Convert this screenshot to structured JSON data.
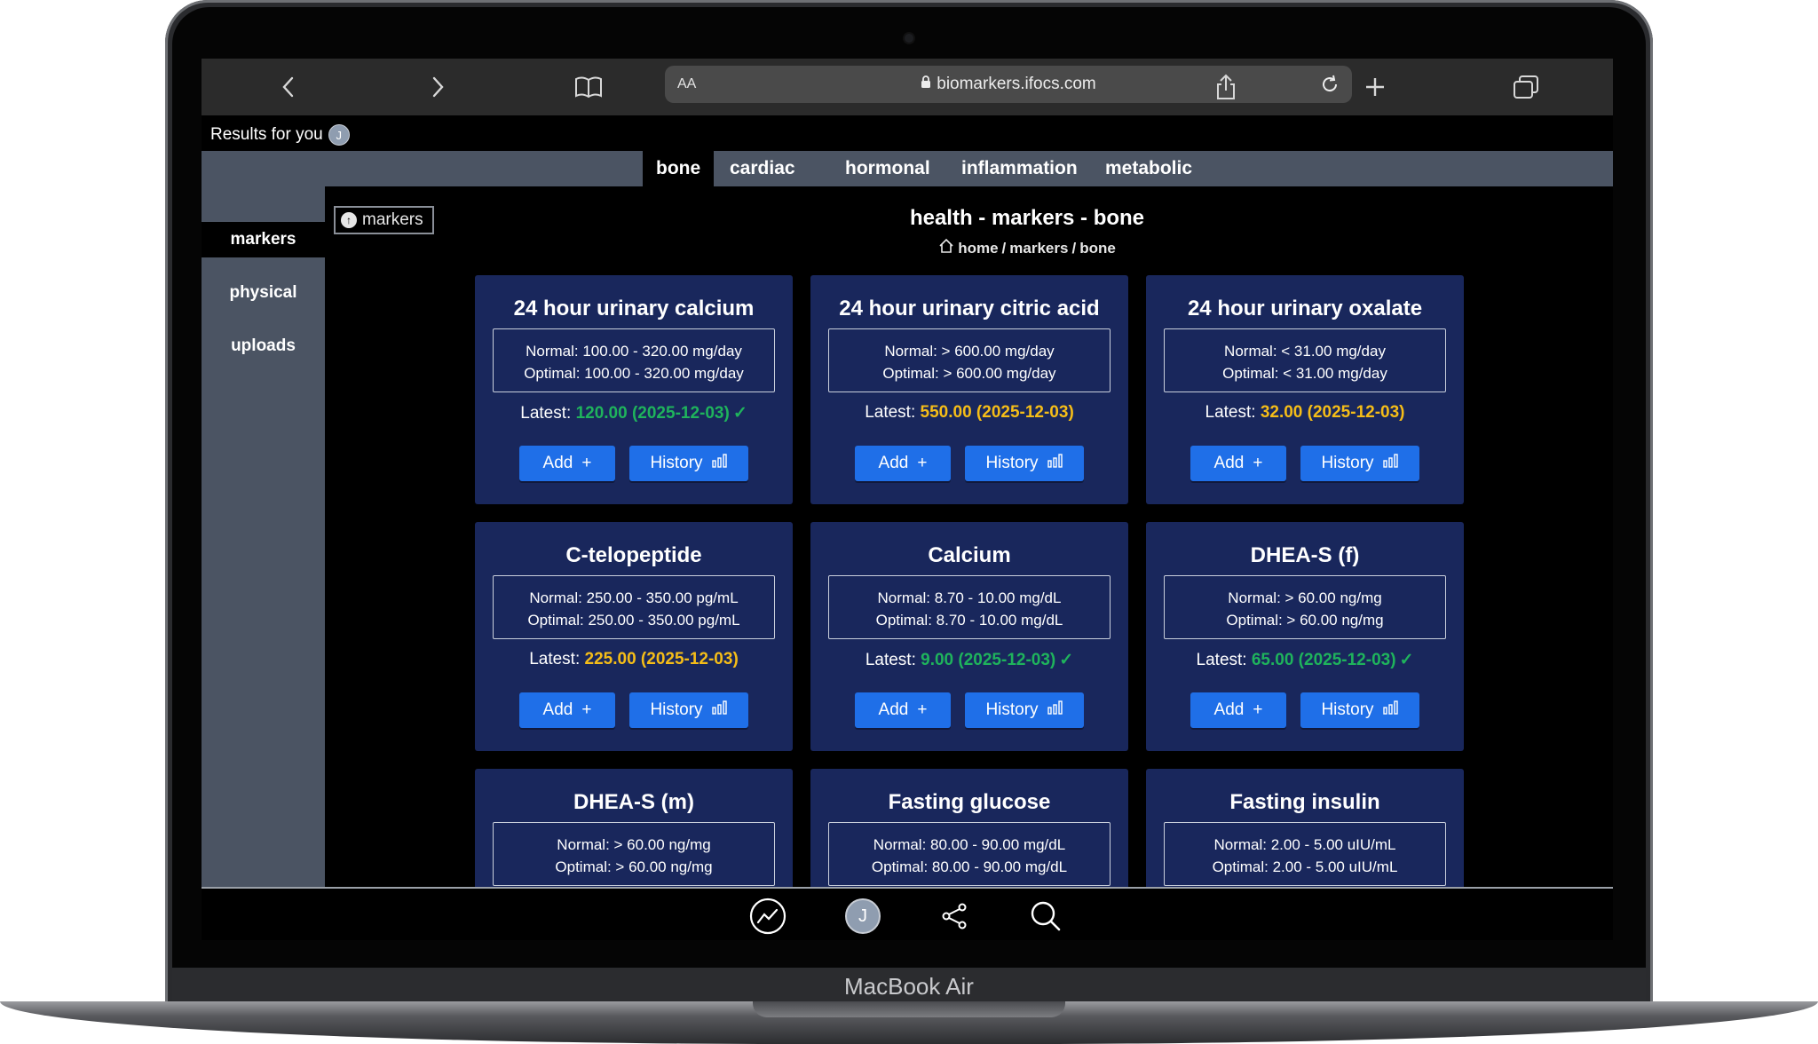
{
  "device": {
    "label": "MacBook Air"
  },
  "browser": {
    "text_size_label": "AA",
    "url": "biomarkers.ifocs.com",
    "icons": [
      "back-icon",
      "forward-icon",
      "bookmarks-icon",
      "lock-icon",
      "reload-icon",
      "share-icon",
      "new-tab-icon",
      "tabs-icon"
    ]
  },
  "header": {
    "results_label": "Results for you",
    "user_initial": "J"
  },
  "tabs": [
    {
      "label": "bone",
      "active": true
    },
    {
      "label": "cardiac",
      "active": false
    },
    {
      "label": "hormonal",
      "active": false
    },
    {
      "label": "inflammation",
      "active": false
    },
    {
      "label": "metabolic",
      "active": false
    }
  ],
  "sidebar": {
    "items": [
      {
        "label": "markers",
        "active": true
      },
      {
        "label": "physical",
        "active": false
      },
      {
        "label": "uploads",
        "active": false
      }
    ]
  },
  "markers_badge": "markers",
  "page": {
    "title": "health - markers - bone",
    "breadcrumb": {
      "home": "home",
      "sep1": "/",
      "markers": "markers",
      "sep2": "/",
      "current": "bone"
    }
  },
  "cards": [
    {
      "title": "24 hour urinary calcium",
      "normal": "Normal: 100.00 - 320.00 mg/day",
      "optimal": "Optimal: 100.00 - 320.00 mg/day",
      "latest_label": "Latest:",
      "latest_value": "120.00 (2025-12-03)",
      "status": "green",
      "check": "✓",
      "add": "Add",
      "history": "History"
    },
    {
      "title": "24 hour urinary citric acid",
      "normal": "Normal: > 600.00 mg/day",
      "optimal": "Optimal: > 600.00 mg/day",
      "latest_label": "Latest:",
      "latest_value": "550.00 (2025-12-03)",
      "status": "amber",
      "check": "",
      "add": "Add",
      "history": "History"
    },
    {
      "title": "24 hour urinary oxalate",
      "normal": "Normal: < 31.00 mg/day",
      "optimal": "Optimal: < 31.00 mg/day",
      "latest_label": "Latest:",
      "latest_value": "32.00 (2025-12-03)",
      "status": "amber",
      "check": "",
      "add": "Add",
      "history": "History"
    },
    {
      "title": "C-telopeptide",
      "normal": "Normal: 250.00 - 350.00 pg/mL",
      "optimal": "Optimal: 250.00 - 350.00 pg/mL",
      "latest_label": "Latest:",
      "latest_value": "225.00 (2025-12-03)",
      "status": "amber",
      "check": "",
      "add": "Add",
      "history": "History"
    },
    {
      "title": "Calcium",
      "normal": "Normal: 8.70 - 10.00 mg/dL",
      "optimal": "Optimal: 8.70 - 10.00 mg/dL",
      "latest_label": "Latest:",
      "latest_value": "9.00 (2025-12-03)",
      "status": "green",
      "check": "✓",
      "add": "Add",
      "history": "History"
    },
    {
      "title": "DHEA-S (f)",
      "normal": "Normal: > 60.00 ng/mg",
      "optimal": "Optimal: > 60.00 ng/mg",
      "latest_label": "Latest:",
      "latest_value": "65.00 (2025-12-03)",
      "status": "green",
      "check": "✓",
      "add": "Add",
      "history": "History"
    },
    {
      "title": "DHEA-S (m)",
      "normal": "Normal: > 60.00 ng/mg",
      "optimal": "Optimal: > 60.00 ng/mg"
    },
    {
      "title": "Fasting glucose",
      "normal": "Normal: 80.00 - 90.00 mg/dL",
      "optimal": "Optimal: 80.00 - 90.00 mg/dL"
    },
    {
      "title": "Fasting insulin",
      "normal": "Normal: 2.00 - 5.00 uIU/mL",
      "optimal": "Optimal: 2.00 - 5.00 uIU/mL"
    }
  ],
  "bottom_bar": {
    "icons": [
      "trend-icon",
      "avatar",
      "share-nodes-icon",
      "search-icon"
    ],
    "user_initial": "J"
  },
  "colors": {
    "card_bg": "#19275c",
    "button": "#1f6fe8",
    "green": "#1fb35c",
    "amber": "#f5bd18",
    "nav_bg": "#4b5463"
  }
}
